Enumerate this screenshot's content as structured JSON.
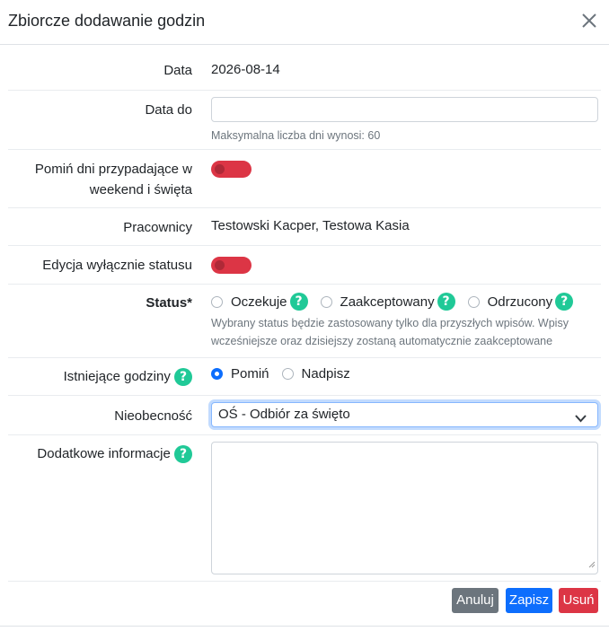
{
  "header": {
    "title": "Zbiorcze dodawanie godzin"
  },
  "fields": {
    "date": {
      "label": "Data",
      "value": "2026-08-14"
    },
    "date_to": {
      "label": "Data do",
      "value": "",
      "hint": "Maksymalna liczba dni wynosi: 60"
    },
    "skip_weekends": {
      "label_line1": "Pomiń dni przypadające w",
      "label_line2": "weekend i święta",
      "enabled": false
    },
    "employees": {
      "label": "Pracownicy",
      "value": "Testowski Kacper, Testowa Kasia"
    },
    "status_only": {
      "label": "Edycja wyłącznie statusu",
      "enabled": false
    },
    "status": {
      "label": "Status*",
      "options": [
        "Oczekuje",
        "Zaakceptowany",
        "Odrzucony"
      ],
      "selected": "",
      "hint_line1": "Wybrany status będzie zastosowany tylko dla przyszłych wpisów. Wpisy",
      "hint_line2": "wcześniejsze oraz dzisiejszy zostaną automatycznie zaakceptowane"
    },
    "existing_hours": {
      "label": "Istniejące godziny",
      "options": [
        "Pomiń",
        "Nadpisz"
      ],
      "selected": "Pomiń"
    },
    "absence": {
      "label": "Nieobecność",
      "value": "OŚ - Odbiór za święto"
    },
    "additional_info": {
      "label": "Dodatkowe informacje",
      "value": ""
    }
  },
  "help_glyph": "?",
  "buttons": {
    "cancel": "Anuluj",
    "save": "Zapisz",
    "delete": "Usuń"
  },
  "colors": {
    "help": "#20c997",
    "toggle_off": "#dc3545",
    "radio_checked": "#0d6efd",
    "btn_cancel": "#6c757d",
    "btn_save": "#0d6efd",
    "btn_delete": "#dc3545"
  }
}
